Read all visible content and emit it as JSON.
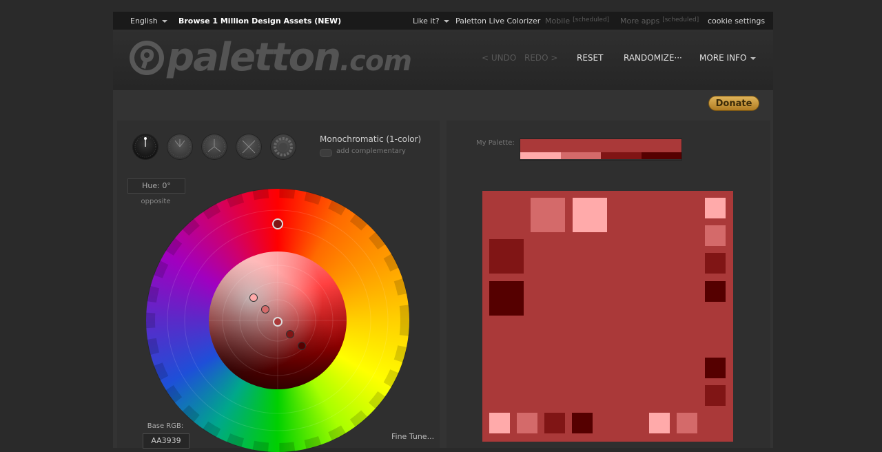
{
  "topbar": {
    "language": "English",
    "browse": "Browse 1 Million Design Assets (NEW)",
    "like": "Like it?",
    "live": "Paletton Live Colorizer",
    "mobile": "Mobile",
    "mobile_tag": "[scheduled]",
    "more_apps": "More apps",
    "more_apps_tag": "[scheduled]",
    "cookie": "cookie settings"
  },
  "header": {
    "logo_main": "paletton",
    "logo_tld": ".com",
    "undo": "< UNDO",
    "redo": "REDO >",
    "reset": "RESET",
    "randomize": "RANDOMIZE···",
    "more_info": "MORE INFO"
  },
  "donate": "Donate",
  "scheme": {
    "name": "Monochromatic (1-color)",
    "add_complementary": "add complementary",
    "hue": "Hue: 0°",
    "opposite": "opposite",
    "base_rgb_label": "Base RGB:",
    "base_rgb": "AA3939",
    "fine_tune": "Fine Tune..."
  },
  "palette": {
    "label": "My Palette:",
    "base": "#AA3939",
    "shades": [
      "#FFAAAA",
      "#D46A6A",
      "#801515",
      "#550000"
    ]
  },
  "colors": {
    "base": "#AA3939",
    "lightest": "#FFAAAA",
    "light": "#D46A6A",
    "dark": "#801515",
    "darkest": "#550000"
  }
}
